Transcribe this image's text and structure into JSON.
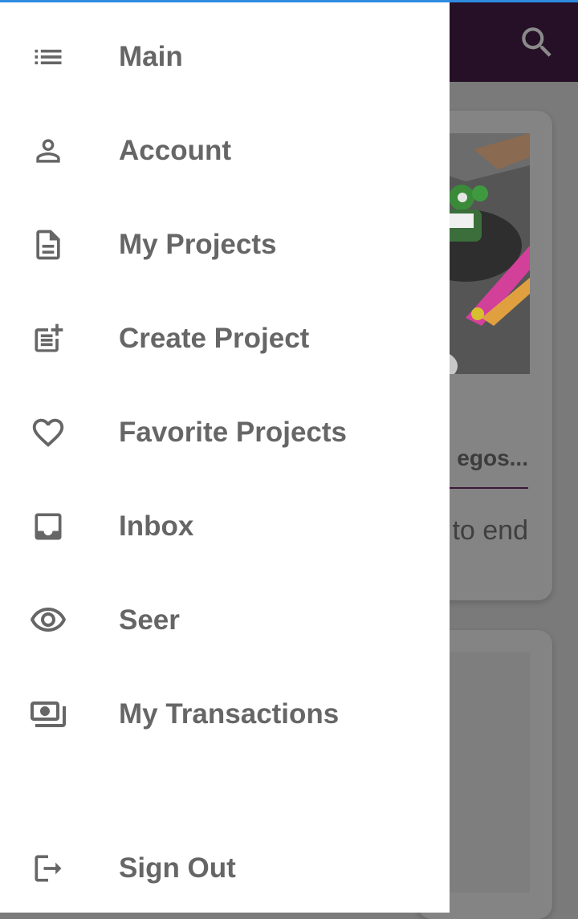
{
  "drawer": {
    "items": [
      {
        "label": "Main",
        "icon": "list-icon"
      },
      {
        "label": "Account",
        "icon": "person-icon"
      },
      {
        "label": "My Projects",
        "icon": "document-icon"
      },
      {
        "label": "Create Project",
        "icon": "post-add-icon"
      },
      {
        "label": "Favorite Projects",
        "icon": "heart-icon"
      },
      {
        "label": "Inbox",
        "icon": "inbox-icon"
      },
      {
        "label": "Seer",
        "icon": "eye-icon"
      },
      {
        "label": "My Transactions",
        "icon": "money-icon"
      }
    ],
    "sign_out": {
      "label": "Sign Out",
      "icon": "logout-icon"
    }
  },
  "appbar": {
    "search_icon": "search-icon",
    "color": "#261027"
  },
  "background_card": {
    "title_fragment": "egos...",
    "text_fragment": "to end"
  },
  "colors": {
    "text": "#666666",
    "accent_line": "#2f8be0",
    "scrim": "#7a7a7a"
  }
}
